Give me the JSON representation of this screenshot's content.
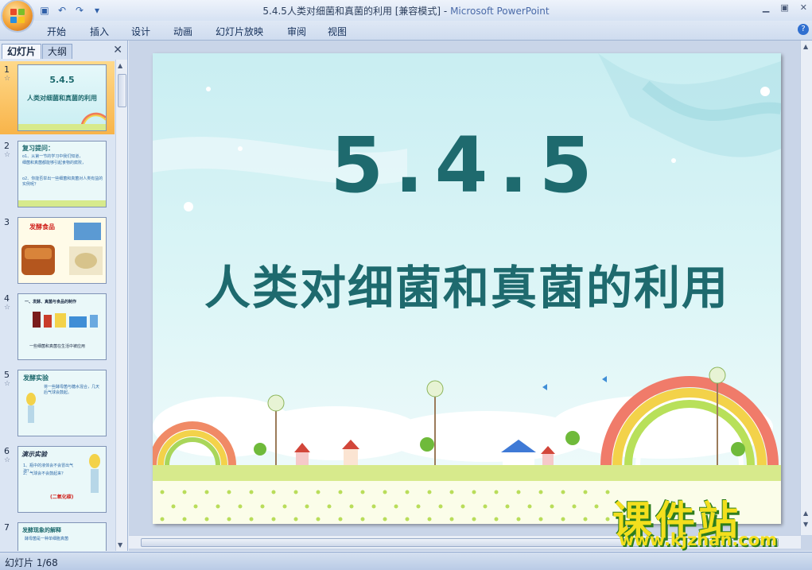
{
  "window": {
    "title": "5.4.5人类对细菌和真菌的利用 [兼容模式] - ",
    "app": "Microsoft PowerPoint"
  },
  "qat": {
    "save_icon": "save-icon",
    "undo_icon": "undo-icon",
    "redo_icon": "redo-icon"
  },
  "ribbon": {
    "tabs": [
      "开始",
      "插入",
      "设计",
      "动画",
      "幻灯片放映",
      "审阅",
      "视图"
    ]
  },
  "panel": {
    "tabs": [
      "幻灯片",
      "大纲"
    ]
  },
  "thumbnails": [
    {
      "num": "1",
      "lines": [
        "5.4.5",
        "人类对细菌和真菌的利用"
      ]
    },
    {
      "num": "2",
      "lines": [
        "复习提问：",
        "o1、从第一节的学习中我们知道，",
        "细菌和真菌都能够引起食物的腐败，",
        "o2、你能否举出一些细菌和真菌对人类有益的实例呢？"
      ]
    },
    {
      "num": "3",
      "lines": [
        "发酵食品"
      ]
    },
    {
      "num": "4",
      "lines": [
        "一、发酵、真菌与食品的制作",
        "一些细菌和真菌在生活中被应用"
      ]
    },
    {
      "num": "5",
      "lines": [
        "发酵实验",
        "将一些酵母菌与糖水混合，几天后气球会鼓起。"
      ]
    },
    {
      "num": "6",
      "lines": [
        "演示实验",
        "1、瓶中的液体会不会冒出气泡？",
        "2、气球会不会鼓起来？",
        "(二氧化碳)"
      ]
    },
    {
      "num": "7",
      "lines": [
        "发酵现象的解释",
        "酵母菌是一种单细胞真菌"
      ]
    }
  ],
  "slide": {
    "title": "5.4.5",
    "subtitle": "人类对细菌和真菌的利用"
  },
  "status": {
    "text": "幻灯片 1/68"
  },
  "watermark": {
    "cn": "课件站",
    "url": "www.kjzhan.com"
  }
}
